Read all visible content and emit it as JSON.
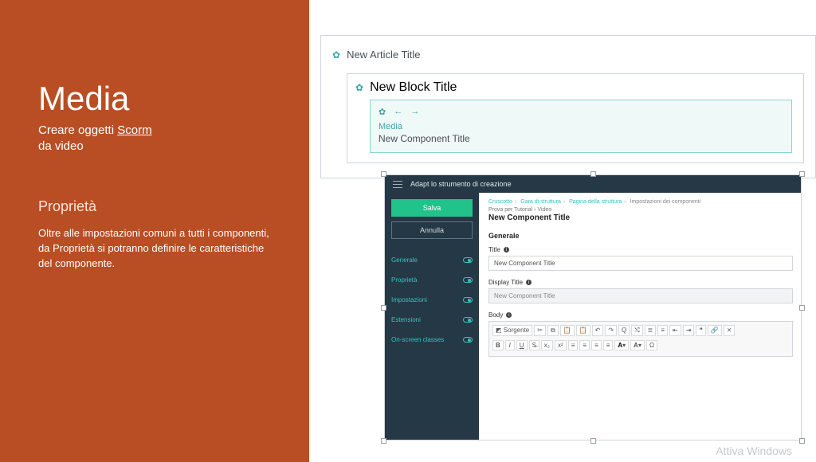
{
  "left": {
    "title": "Media",
    "subtitle_pre": "Creare oggetti ",
    "subtitle_un": "Scorm",
    "subtitle_post": "da video",
    "section": "Proprietà",
    "paragraph": "Oltre alle impostazioni comuni a tutti i componenti, da Proprietà si potranno definire le caratteristiche del componente."
  },
  "blocks": {
    "article": "New Article Title",
    "block": "New Block Title",
    "component_label": "Media",
    "component": "New Component Title"
  },
  "embed": {
    "app": "Adapt lo strumento di creazione",
    "save": "Salva",
    "cancel": "Annulla",
    "nav": [
      "Generale",
      "Proprietà",
      "Impostazioni",
      "Estensioni",
      "On-screen classes"
    ],
    "crumbs": [
      "Cruscotto",
      "Gara di struttura",
      "Pagina della struttura"
    ],
    "crumb_current": "Impostazioni dei componenti",
    "path_sub": "Prova per Tutorial › Video",
    "page_title": "New Component Title",
    "section_generale": "Generale",
    "field_title": "Title",
    "value_title": "New Component Title",
    "field_display": "Display Title",
    "value_display": "New Component Title",
    "field_body": "Body",
    "tb_sorgente": "Sorgente"
  },
  "watermark": "Attiva Windows"
}
